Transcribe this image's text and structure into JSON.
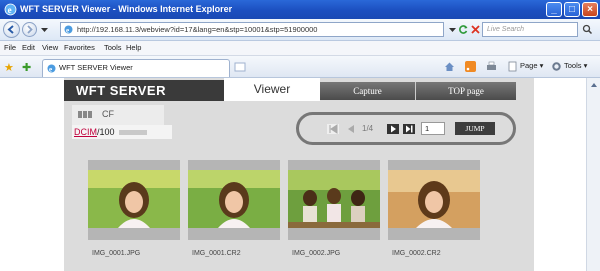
{
  "window": {
    "title": "WFT SERVER Viewer - Windows Internet Explorer",
    "controls": [
      "_",
      "□",
      "×"
    ]
  },
  "address_bar": {
    "url": "http://192.168.11.3/webview?id=17&lang=en&stp=10001&stp=51900000",
    "search_placeholder": "Live Search"
  },
  "menu": [
    "File",
    "Edit",
    "View",
    "Favorites",
    "Tools",
    "Help"
  ],
  "tab": {
    "label": "WFT SERVER Viewer"
  },
  "command_bar": [
    "Page ▾",
    "Tools ▾"
  ],
  "page": {
    "logo": "WFT SERVER",
    "nav": {
      "viewer": "Viewer",
      "capture": "Capture",
      "top_page": "TOP page"
    },
    "media": {
      "cf": "CF"
    },
    "folder": {
      "link": "DCIM",
      "suffix": "/100"
    },
    "pager": {
      "page_count": "1/4",
      "page_value": "1",
      "jump_label": "JUMP"
    },
    "thumbnails": [
      {
        "filename": "IMG_0001.JPG"
      },
      {
        "filename": "IMG_0001.CR2"
      },
      {
        "filename": "IMG_0002.JPG"
      },
      {
        "filename": "IMG_0002.CR2"
      }
    ]
  },
  "colors": {
    "titlebar": "#1f55c8",
    "page_bg": "#dcdcdc",
    "nav_dark": "#4b4b4b",
    "folder_link": "#c0003c",
    "jump_button": "#3d3d3d"
  }
}
